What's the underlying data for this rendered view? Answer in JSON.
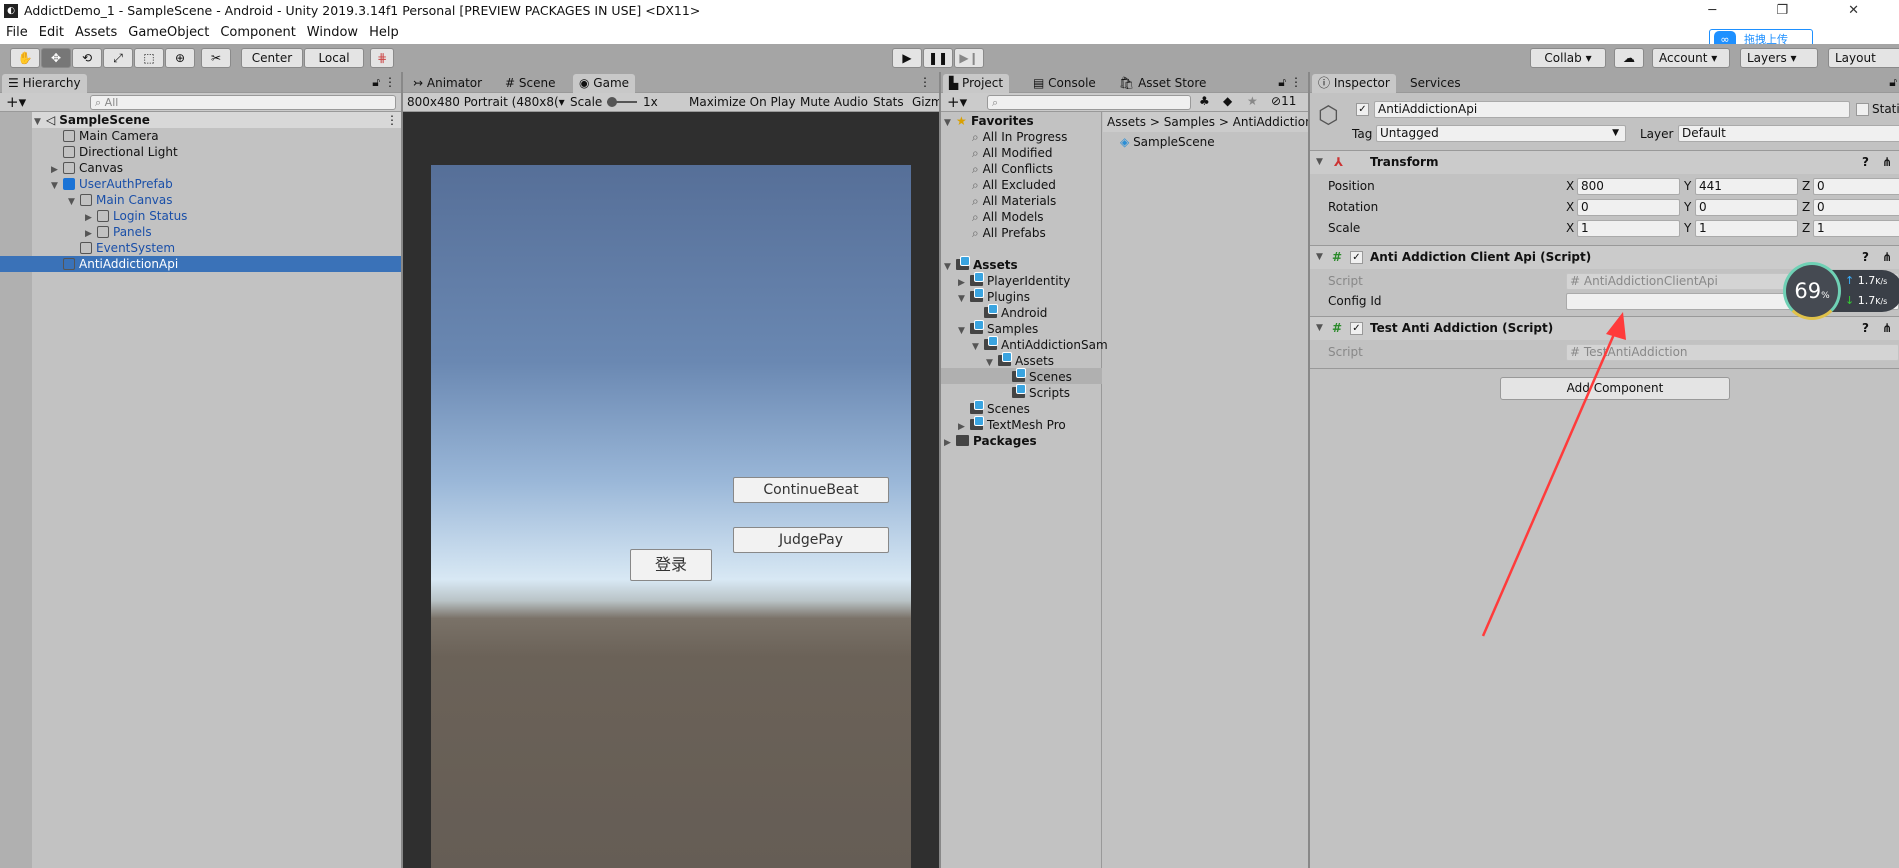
{
  "window": {
    "title": "AddictDemo_1 - SampleScene - Android - Unity 2019.3.14f1 Personal [PREVIEW PACKAGES IN USE] <DX11>",
    "controls": "─ ❐ ✕"
  },
  "menu": [
    "File",
    "Edit",
    "Assets",
    "GameObject",
    "Component",
    "Window",
    "Help"
  ],
  "toolbar": {
    "center": "Center",
    "local": "Local",
    "collab": "Collab ▾",
    "account": "Account",
    "layers": "Layers",
    "layout": "Layout"
  },
  "upload_widget": {
    "label": "拖拽上传",
    "color": "#1e90ff"
  },
  "hierarchy": {
    "tab": "Hierarchy",
    "search_placeholder": "All",
    "items": [
      {
        "label": "SampleScene",
        "depth": 0,
        "expand": "open",
        "type": "scene"
      },
      {
        "label": "Main Camera",
        "depth": 1,
        "expand": "none"
      },
      {
        "label": "Directional Light",
        "depth": 1,
        "expand": "none"
      },
      {
        "label": "Canvas",
        "depth": 1,
        "expand": "closed"
      },
      {
        "label": "UserAuthPrefab",
        "depth": 1,
        "expand": "open",
        "prefab": true
      },
      {
        "label": "Main Canvas",
        "depth": 2,
        "expand": "open",
        "prefab": true
      },
      {
        "label": "Login Status",
        "depth": 3,
        "expand": "closed",
        "prefab": true
      },
      {
        "label": "Panels",
        "depth": 3,
        "expand": "closed",
        "prefab": true
      },
      {
        "label": "EventSystem",
        "depth": 2,
        "expand": "none",
        "prefab": true
      },
      {
        "label": "AntiAddictionApi",
        "depth": 1,
        "expand": "none",
        "selected": true
      }
    ]
  },
  "game": {
    "tabs": [
      "Animator",
      "Scene",
      "Game"
    ],
    "resolution": "800x480 Portrait (480x8(",
    "scale_label": "Scale",
    "scale_value": "1x",
    "maximize": "Maximize On Play",
    "mute": "Mute Audio",
    "stats": "Stats",
    "gizmos": "Gizm",
    "buttons": {
      "continue": "ContinueBeat",
      "judge": "JudgePay",
      "login": "登录"
    }
  },
  "project": {
    "tabs": [
      "Project",
      "Console",
      "Asset Store"
    ],
    "hidden_count": "11",
    "favorites": {
      "label": "Favorites",
      "items": [
        "All In Progress",
        "All Modified",
        "All Conflicts",
        "All Excluded",
        "All Materials",
        "All Models",
        "All Prefabs"
      ]
    },
    "tree": [
      {
        "label": "Assets",
        "depth": 0,
        "expand": "open",
        "bold": true
      },
      {
        "label": "PlayerIdentity",
        "depth": 1,
        "expand": "closed"
      },
      {
        "label": "Plugins",
        "depth": 1,
        "expand": "open"
      },
      {
        "label": "Android",
        "depth": 2,
        "expand": "none"
      },
      {
        "label": "Samples",
        "depth": 1,
        "expand": "open"
      },
      {
        "label": "AntiAddictionSam",
        "depth": 2,
        "expand": "open"
      },
      {
        "label": "Assets",
        "depth": 3,
        "expand": "open"
      },
      {
        "label": "Scenes",
        "depth": 4,
        "expand": "none",
        "selected": true
      },
      {
        "label": "Scripts",
        "depth": 4,
        "expand": "none"
      },
      {
        "label": "Scenes",
        "depth": 1,
        "expand": "none"
      },
      {
        "label": "TextMesh Pro",
        "depth": 1,
        "expand": "closed"
      },
      {
        "label": "Packages",
        "depth": 0,
        "expand": "closed",
        "bold": true,
        "plain": true
      }
    ],
    "breadcrumb": [
      "Assets",
      "Samples",
      "AntiAddictionS"
    ],
    "files": [
      "SampleScene"
    ]
  },
  "inspector": {
    "tabs": [
      "Inspector",
      "Services"
    ],
    "object_name": "AntiAddictionApi",
    "static_label": "Static",
    "tag_label": "Tag",
    "tag": "Untagged",
    "layer_label": "Layer",
    "layer": "Default",
    "transform": {
      "title": "Transform",
      "rows": [
        {
          "label": "Position",
          "x": "800",
          "y": "441",
          "z": "0"
        },
        {
          "label": "Rotation",
          "x": "0",
          "y": "0",
          "z": "0"
        },
        {
          "label": "Scale",
          "x": "1",
          "y": "1",
          "z": "1"
        }
      ]
    },
    "comp1": {
      "title": "Anti Addiction Client Api (Script)",
      "script_label": "Script",
      "script": "AntiAddictionClientApi",
      "config_label": "Config Id",
      "config_value": ""
    },
    "comp2": {
      "title": "Test Anti Addiction (Script)",
      "script_label": "Script",
      "script": "TestAntiAddiction"
    },
    "add_component": "Add Component"
  },
  "net_widget": {
    "percent": "69",
    "pct_sign": "%",
    "up": "1.7",
    "down": "1.7",
    "unit": "K/s"
  },
  "annotation_arrow_color": "#ff3b3b"
}
